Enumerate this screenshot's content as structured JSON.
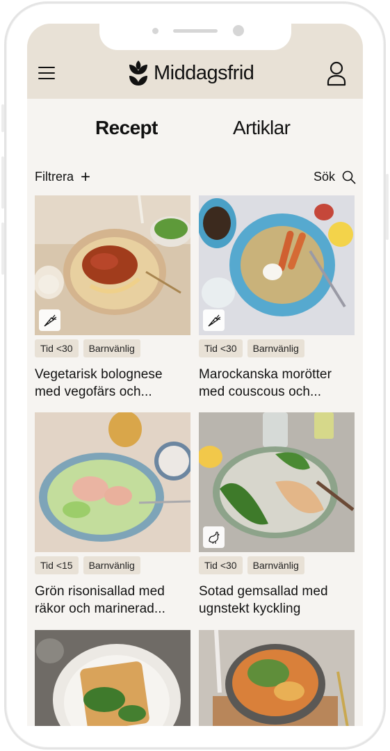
{
  "header": {
    "brand": "Middagsfrid"
  },
  "tabs": [
    {
      "label": "Recept",
      "active": true
    },
    {
      "label": "Artiklar",
      "active": false
    }
  ],
  "filter": {
    "label": "Filtrera"
  },
  "search": {
    "label": "Sök"
  },
  "recipes": [
    {
      "tags": [
        "Tid <30",
        "Barnvänlig"
      ],
      "title_line1": "Vegetarisk bolognese",
      "title_line2": "med vegofärs och...",
      "badge": "carrot-icon"
    },
    {
      "tags": [
        "Tid <30",
        "Barnvänlig"
      ],
      "title_line1": "Marockanska morötter",
      "title_line2": "med couscous och...",
      "badge": "carrot-icon"
    },
    {
      "tags": [
        "Tid <15",
        "Barnvänlig"
      ],
      "title_line1": "Grön risonisallad med",
      "title_line2": "räkor och marinerad...",
      "badge": null
    },
    {
      "tags": [
        "Tid <30",
        "Barnvänlig"
      ],
      "title_line1": "Sotad gemsallad med",
      "title_line2": "ugnstekt kyckling",
      "badge": "chicken-icon"
    },
    {
      "tags": [],
      "title_line1": "",
      "title_line2": "",
      "badge": null
    },
    {
      "tags": [],
      "title_line1": "",
      "title_line2": "",
      "badge": null
    }
  ],
  "colors": {
    "header_bg": "#e8e1d6",
    "screen_bg": "#f6f4f1",
    "tag_bg": "#e8e1d6",
    "text": "#111111"
  }
}
